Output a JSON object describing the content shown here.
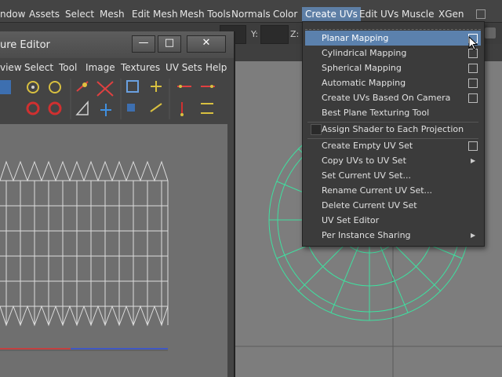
{
  "menubar": {
    "items": [
      {
        "label": "ndow"
      },
      {
        "label": "Assets"
      },
      {
        "label": "Select"
      },
      {
        "label": "Mesh"
      },
      {
        "label": "Edit Mesh"
      },
      {
        "label": "Mesh Tools"
      },
      {
        "label": "Normals"
      },
      {
        "label": "Color"
      },
      {
        "label": "Create UVs"
      },
      {
        "label": "Edit UVs"
      },
      {
        "label": "Muscle"
      },
      {
        "label": "XGen"
      }
    ]
  },
  "toolstrip": {
    "y_label": "Y:",
    "z_label": "Z:"
  },
  "uv_editor": {
    "title": "ure Editor",
    "min_label": "—",
    "max_label": "□",
    "close_label": "✕",
    "menus": [
      {
        "label": "view"
      },
      {
        "label": "Select"
      },
      {
        "label": "Tool"
      },
      {
        "label": "Image"
      },
      {
        "label": "Textures"
      },
      {
        "label": "UV Sets"
      },
      {
        "label": "Help"
      }
    ]
  },
  "dropdown": {
    "items": [
      {
        "label": "Planar Mapping",
        "highlight": true,
        "option_box": true
      },
      {
        "label": "Cylindrical Mapping",
        "option_box": true
      },
      {
        "label": "Spherical Mapping",
        "option_box": true
      },
      {
        "label": "Automatic Mapping",
        "option_box": true
      },
      {
        "label": "Create UVs Based On Camera",
        "option_box": true
      },
      {
        "label": "Best Plane Texturing Tool"
      },
      {
        "label": "Assign Shader to Each Projection",
        "checkbox": true
      },
      {
        "label": "Create Empty UV Set",
        "option_box": true
      },
      {
        "label": "Copy UVs to UV Set",
        "submenu": true
      },
      {
        "label": "Set Current UV Set..."
      },
      {
        "label": "Rename Current UV Set..."
      },
      {
        "label": "Delete Current UV Set"
      },
      {
        "label": "UV Set Editor"
      },
      {
        "label": "Per Instance Sharing",
        "submenu": true
      }
    ]
  },
  "colors": {
    "accent": "#5b81ad",
    "wireframe": "#3fe0a0",
    "uv_lines": "#ffffff"
  }
}
